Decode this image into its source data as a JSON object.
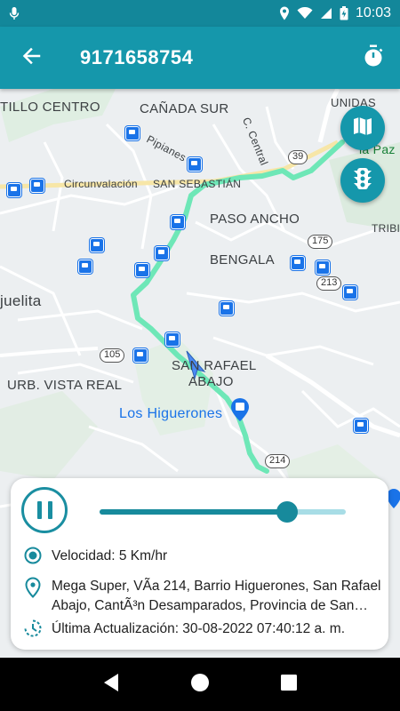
{
  "status_bar": {
    "time": "10:03",
    "icons": [
      "mic-icon",
      "location-icon",
      "wifi-icon",
      "signal-icon",
      "battery-icon"
    ]
  },
  "app_bar": {
    "title": "9171658754",
    "back_icon": "arrow-back-icon",
    "action_icon": "timer-icon"
  },
  "map": {
    "labels": {
      "castillo_centro": "TILLO CENTRO",
      "canada_sur": "CAÑADA SUR",
      "c_central": "C. Central",
      "pipianes": "Pipianes",
      "circunvalacion": "Circunvalación",
      "san_sebastian": "SAN SEBASTIÁN",
      "paso_ancho": "PASO ANCHO",
      "bengala": "BENGALA",
      "juelita": "juelita",
      "vista_real": "URB. VISTA REAL",
      "san_rafael_1": "SAN RAFAEL",
      "san_rafael_2": "ABAJO",
      "los_higuerones": "Los Higuerones",
      "unidas": "UNIDAS",
      "tribu": "TRIBI",
      "paz": "la Paz"
    },
    "route_shields": [
      "39",
      "175",
      "213",
      "105",
      "214"
    ],
    "fab_icons": [
      "map-icon",
      "traffic-light-icon"
    ],
    "route_color": "#6ee7b7"
  },
  "info_card": {
    "playback_icon": "pause-icon",
    "progress": 0.76,
    "speed_label": "Velocidad: 5 Km/hr",
    "address_label": "Mega Super, VÃa 214, Barrio Higuerones, San Rafael Abajo, CantÃ³n Desamparados, Provincia de San José",
    "last_update_label": "Última Actualización: 30-08-2022 07:40:12 a. m."
  },
  "nav_bar": {
    "buttons": [
      "back-icon",
      "home-icon",
      "recents-icon"
    ]
  },
  "colors": {
    "primary": "#1597ab",
    "status_bar": "#13879a",
    "accent_dark": "#178a9c",
    "route": "#6ee7b7"
  }
}
